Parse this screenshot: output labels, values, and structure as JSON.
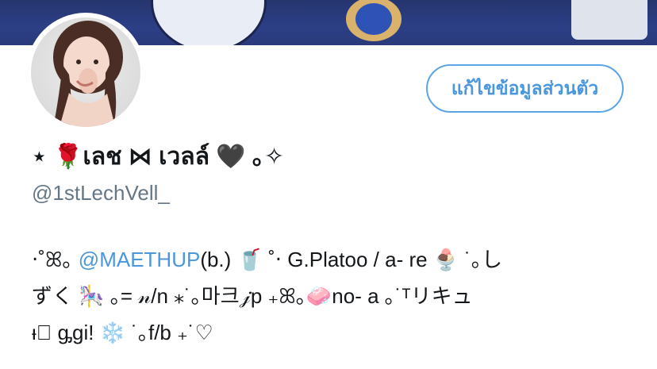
{
  "profile": {
    "edit_button_label": "แก้ไขข้อมูลส่วนตัว",
    "display_name": "⋆ 🌹เลช ⋈ เวลล์ 🖤 ｡✧",
    "handle": "@1stLechVell_",
    "bio": {
      "line1_prefix": "‧˚ꕤ｡",
      "line1_mention": "@MAETHUP",
      "line1_rest": "(b.) 🥤 ˚‧ G.Platoo / a- re 🍨 ˙｡し",
      "line2": "ずく 🎠 ｡= 𝓃/n ⁎˙｡마크𝒿p ₊ꕤ｡🧼no- a ｡˙ᵀリキュ",
      "line3": "ᵻ⃞ ᶃgi! ❄️ ˙｡f/b ₊˙♡"
    }
  },
  "colors": {
    "accent": "#4a97de",
    "banner": "#2c3f86",
    "secondary_text": "#657786"
  }
}
